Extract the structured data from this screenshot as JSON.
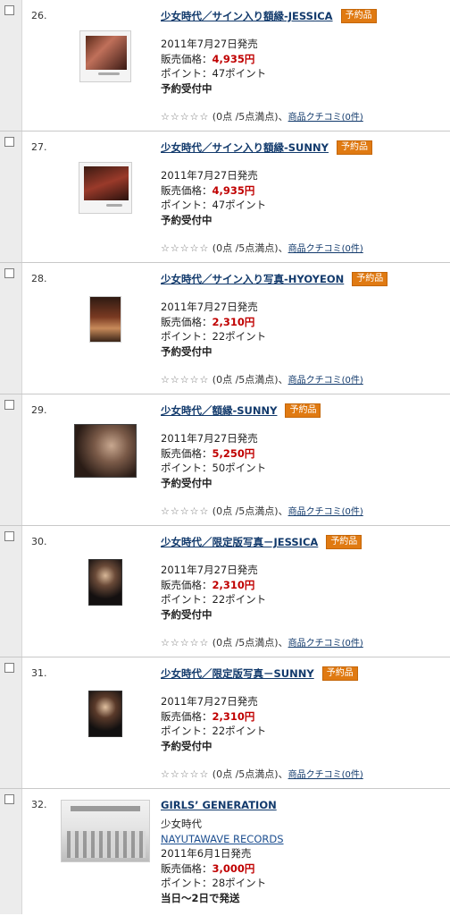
{
  "labels": {
    "release_suffix": "発売",
    "price_label": "販売価格：",
    "points_label": "ポイント：",
    "badge": "予約品",
    "reservation": "予約受付中",
    "stars": "☆☆☆☆☆",
    "rating_text": " (0点 /5点満点)、",
    "review_link": "商品クチコミ(0件)"
  },
  "items": [
    {
      "num": "26.",
      "title": "少女時代／サイン入り額縁-JESSICA",
      "date": "2011年7月27日",
      "price": "4,935円",
      "points": "47ポイント",
      "status": "予約受付中",
      "thumb": "frame-jessica"
    },
    {
      "num": "27.",
      "title": "少女時代／サイン入り額縁-SUNNY",
      "date": "2011年7月27日",
      "price": "4,935円",
      "points": "47ポイント",
      "status": "予約受付中",
      "thumb": "frame-sunny"
    },
    {
      "num": "28.",
      "title": "少女時代／サイン入り写真-HYOYEON",
      "date": "2011年7月27日",
      "price": "2,310円",
      "points": "22ポイント",
      "status": "予約受付中",
      "thumb": "photo-hyoyeon"
    },
    {
      "num": "29.",
      "title": "少女時代／額縁-SUNNY",
      "date": "2011年7月27日",
      "price": "5,250円",
      "points": "50ポイント",
      "status": "予約受付中",
      "thumb": "frame2-sunny"
    },
    {
      "num": "30.",
      "title": "少女時代／限定版写真－JESSICA",
      "date": "2011年7月27日",
      "price": "2,310円",
      "points": "22ポイント",
      "status": "予約受付中",
      "thumb": "photo-jessica"
    },
    {
      "num": "31.",
      "title": "少女時代／限定版写真－SUNNY",
      "date": "2011年7月27日",
      "price": "2,310円",
      "points": "22ポイント",
      "status": "予約受付中",
      "thumb": "photo-sunny"
    },
    {
      "num": "32.",
      "title": "GIRLS’ GENERATION",
      "artist": "少女時代",
      "label": "NAYUTAWAVE RECORDS",
      "date": "2011年6月1日",
      "price": "3,000円",
      "points": "28ポイント",
      "status": "当日～2日で発送",
      "thumb": "album-cover"
    }
  ],
  "colors": {
    "price": "#c00000",
    "link": "#123a6c",
    "badge": "#e07a12",
    "gutter": "#ececec"
  }
}
